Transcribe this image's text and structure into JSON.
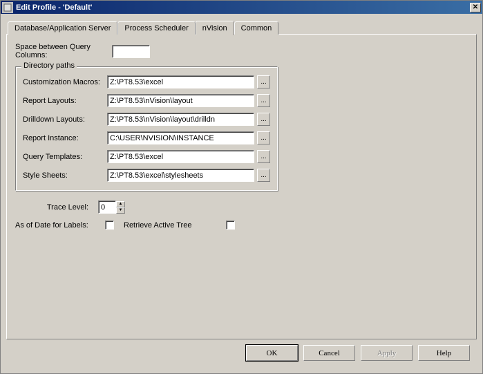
{
  "window": {
    "title": "Edit Profile - 'Default'"
  },
  "tabs": {
    "items": [
      {
        "label": "Database/Application Server"
      },
      {
        "label": "Process Scheduler"
      },
      {
        "label": "nVision"
      },
      {
        "label": "Common"
      }
    ]
  },
  "nvision": {
    "space_label": "Space between Query Columns:",
    "space_value": "",
    "dirpaths_legend": "Directory paths",
    "fields": {
      "macros": {
        "label": "Customization Macros:",
        "value": "Z:\\PT8.53\\excel"
      },
      "layouts": {
        "label": "Report Layouts:",
        "value": "Z:\\PT8.53\\nVision\\layout"
      },
      "drilldn": {
        "label": "Drilldown Layouts:",
        "value": "Z:\\PT8.53\\nVision\\layout\\drilldn"
      },
      "instance": {
        "label": "Report Instance:",
        "value": "C:\\USER\\NVISION\\INSTANCE"
      },
      "querytpl": {
        "label": "Query Templates:",
        "value": "Z:\\PT8.53\\excel"
      },
      "styles": {
        "label": "Style Sheets:",
        "value": "Z:\\PT8.53\\excel\\stylesheets"
      }
    },
    "browse_label": "...",
    "trace_label": "Trace Level:",
    "trace_value": "0",
    "asofdate_label": "As of Date for Labels:",
    "retrieve_label": "Retrieve Active Tree"
  },
  "buttons": {
    "ok": "OK",
    "cancel": "Cancel",
    "apply": "Apply",
    "help": "Help"
  }
}
